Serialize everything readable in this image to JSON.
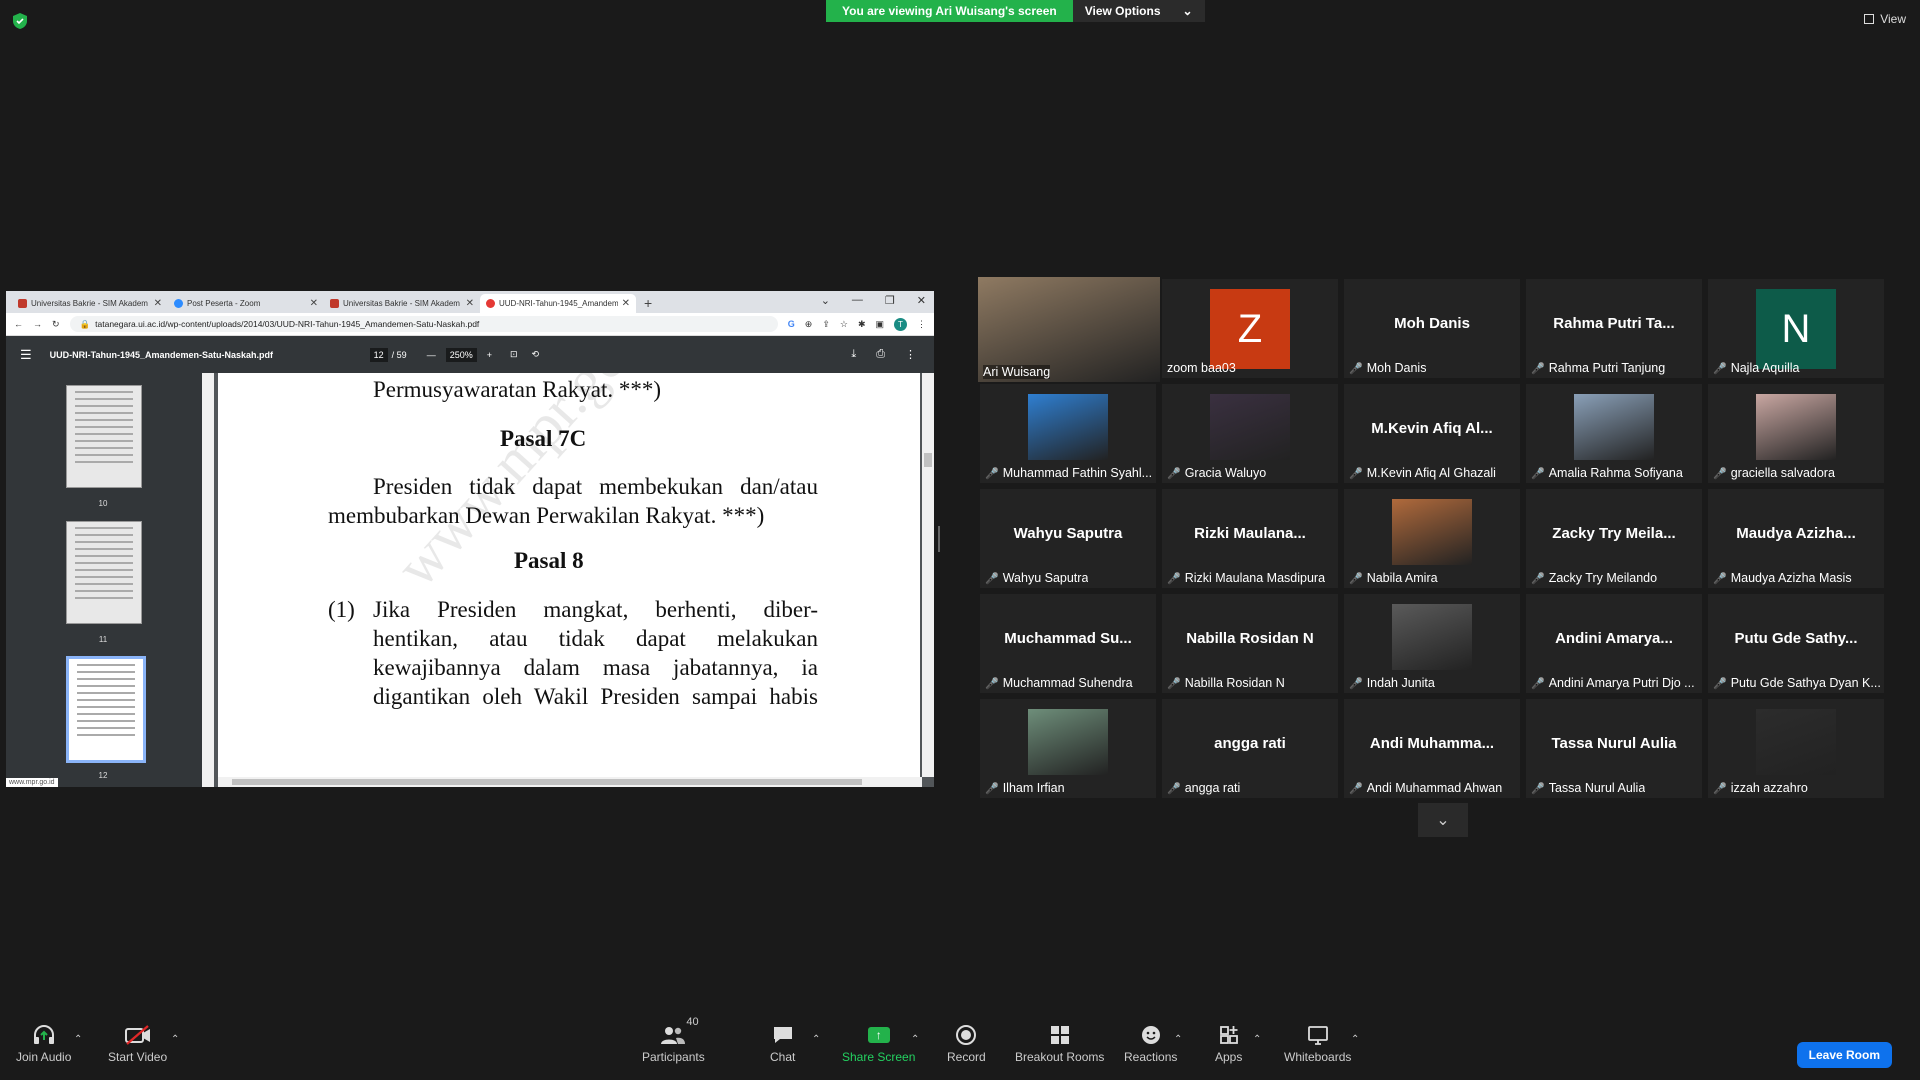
{
  "banner": {
    "viewing_text": "You are viewing Ari Wuisang's screen",
    "view_options_label": "View Options",
    "view_label": "View"
  },
  "browser": {
    "tabs": [
      {
        "label": "Universitas Bakrie - SIM Akadem",
        "favicon_color": "#c0392b"
      },
      {
        "label": "Post Peserta - Zoom",
        "favicon_color": "#2d8cff"
      },
      {
        "label": "Universitas Bakrie - SIM Akadem",
        "favicon_color": "#c0392b"
      },
      {
        "label": "UUD-NRI-Tahun-1945_Amandem",
        "favicon_color": "#e53935"
      }
    ],
    "url": "tatanegara.ui.ac.id/wp-content/uploads/2014/03/UUD-NRI-Tahun-1945_Amandemen-Satu-Naskah.pdf",
    "profile_initial": "T",
    "pdf": {
      "filename": "UUD-NRI-Tahun-1945_Amandemen-Satu-Naskah.pdf",
      "current_page": "12",
      "total_pages": "/ 59",
      "zoom": "250%",
      "thumbnails": [
        "10",
        "11",
        "12"
      ],
      "source_tag": "www.mpr.go.id",
      "watermark": "www.mpr.go.id",
      "content": {
        "line1": "Permusyawaratan Rakyat. ***)",
        "heading1": "Pasal 7C",
        "para1_line1": "Presiden tidak dapat membekukan dan/atau",
        "para1_line2": "membubarkan Dewan Perwakilan Rakyat. ***)",
        "heading2": "Pasal 8",
        "item_number": "(1)",
        "item_line1": "Jika Presiden mangkat, berhenti, diber-",
        "item_line2": "hentikan, atau tidak dapat melakukan",
        "item_line3": "kewajibannya dalam masa jabatannya, ia",
        "item_line4": "digantikan oleh Wakil Presiden sampai habis"
      }
    }
  },
  "participants": [
    {
      "display": "",
      "label": "Ari Wuisang",
      "muted": false,
      "speaking": true,
      "photo": "#8f7a62"
    },
    {
      "display": "Z",
      "label": "zoom baa03",
      "muted": false,
      "initial_bg": "#c83a12"
    },
    {
      "display": "Moh Danis",
      "label": "Moh Danis",
      "muted": true
    },
    {
      "display": "Rahma Putri Ta...",
      "label": "Rahma Putri Tanjung",
      "muted": true
    },
    {
      "display": "N",
      "label": "Najla Aquilla",
      "muted": true,
      "initial_bg": "#0d5b49"
    },
    {
      "display": "",
      "label": "Muhammad Fathin Syahl...",
      "muted": true,
      "photo": "#2f7fd1"
    },
    {
      "display": "",
      "label": "Gracia Waluyo",
      "muted": true,
      "photo": "#3a3040"
    },
    {
      "display": "M.Kevin Afiq Al...",
      "label": "M.Kevin Afiq Al Ghazali",
      "muted": true
    },
    {
      "display": "",
      "label": "Amalia Rahma Sofiyana",
      "muted": true,
      "photo": "#8aa0b8"
    },
    {
      "display": "",
      "label": "graciella salvadora",
      "muted": true,
      "photo": "#c9a7a2"
    },
    {
      "display": "Wahyu Saputra",
      "label": "Wahyu Saputra",
      "muted": true
    },
    {
      "display": "Rizki Maulana...",
      "label": "Rizki Maulana Masdipura",
      "muted": true
    },
    {
      "display": "",
      "label": "Nabila Amira",
      "muted": true,
      "photo": "#b06a3c"
    },
    {
      "display": "Zacky Try Meila...",
      "label": "Zacky Try Meilando",
      "muted": true
    },
    {
      "display": "Maudya Azizha...",
      "label": "Maudya Azizha Masis",
      "muted": true
    },
    {
      "display": "Muchammad Su...",
      "label": "Muchammad Suhendra",
      "muted": true
    },
    {
      "display": "Nabilla Rosidan N",
      "label": "Nabilla Rosidan N",
      "muted": true
    },
    {
      "display": "",
      "label": "Indah Junita",
      "muted": true,
      "photo": "#5a5a5a"
    },
    {
      "display": "Andini Amarya...",
      "label": "Andini Amarya Putri Djo ...",
      "muted": true
    },
    {
      "display": "Putu Gde Sathy...",
      "label": "Putu Gde Sathya Dyan K...",
      "muted": true
    },
    {
      "display": "",
      "label": "Ilham Irfian",
      "muted": true,
      "photo": "#6e8e7a"
    },
    {
      "display": "angga rati",
      "label": "angga rati",
      "muted": true
    },
    {
      "display": "Andi Muhamma...",
      "label": "Andi Muhammad Ahwan",
      "muted": true
    },
    {
      "display": "Tassa Nurul Aulia",
      "label": "Tassa Nurul Aulia",
      "muted": true
    },
    {
      "display": "",
      "label": "izzah azzahro",
      "muted": true,
      "photo": "#2c2c2c"
    }
  ],
  "toolbar": {
    "join_audio": "Join Audio",
    "start_video": "Start Video",
    "participants": "Participants",
    "participants_count": "40",
    "chat": "Chat",
    "share_screen": "Share Screen",
    "record": "Record",
    "breakout_rooms": "Breakout Rooms",
    "reactions": "Reactions",
    "apps": "Apps",
    "whiteboards": "Whiteboards",
    "leave_room": "Leave Room"
  },
  "colors": {
    "banner_green": "#23b24b",
    "speaking_border": "#c7f464",
    "leave_blue": "#0e72ed",
    "muted_red": "#e02828"
  }
}
